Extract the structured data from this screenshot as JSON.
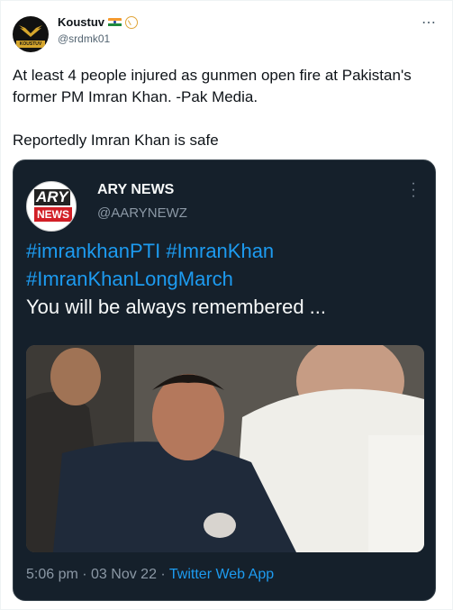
{
  "tweet": {
    "author_name": "Koustuv",
    "author_handle": "@srdmk01",
    "avatar_text": "KOUSTUV",
    "body_line1": "At least 4 people injured as gunmen open fire at Pakistan's former PM Imran Khan.  -Pak Media.",
    "body_line2": "Reportedly Imran Khan is safe",
    "more_icon": "⋯"
  },
  "quoted": {
    "logo_top": "ARY",
    "logo_bottom": "NEWS",
    "name": "ARY NEWS",
    "handle": "@AARYNEWZ",
    "hashtag1": "#imrankhanPTI",
    "hashtag2": "#ImranKhan",
    "hashtag3": "#ImranKhanLongMarch",
    "text": "You will be always remembered ...",
    "time": "5:06 pm",
    "date": "03 Nov 22",
    "source": "Twitter Web App",
    "sep": " · "
  },
  "colors": {
    "link": "#1d9bf0",
    "dark_card": "#15202b",
    "muted": "#536471"
  }
}
